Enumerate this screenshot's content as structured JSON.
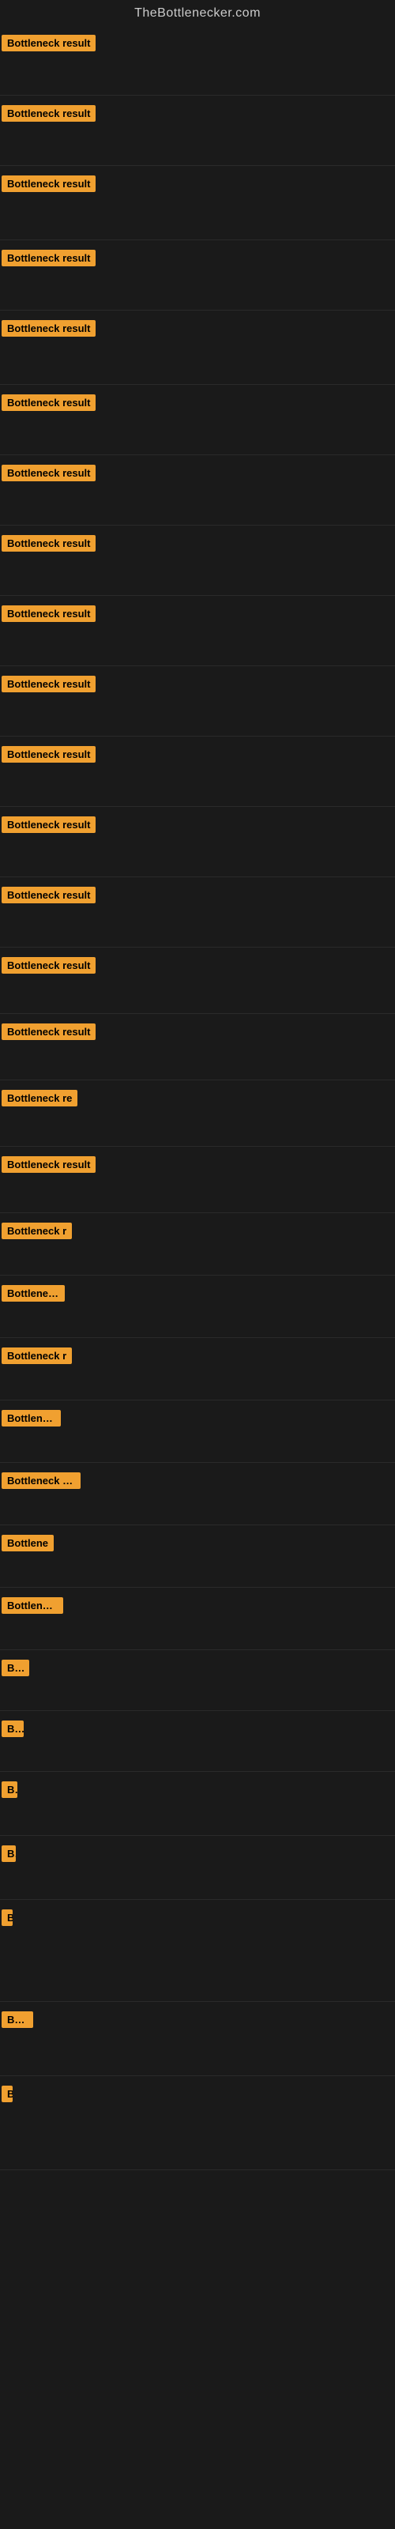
{
  "site": {
    "title": "TheBottlenecker.com"
  },
  "items": [
    {
      "id": 1,
      "label": "Bottleneck result"
    },
    {
      "id": 2,
      "label": "Bottleneck result"
    },
    {
      "id": 3,
      "label": "Bottleneck result"
    },
    {
      "id": 4,
      "label": "Bottleneck result"
    },
    {
      "id": 5,
      "label": "Bottleneck result"
    },
    {
      "id": 6,
      "label": "Bottleneck result"
    },
    {
      "id": 7,
      "label": "Bottleneck result"
    },
    {
      "id": 8,
      "label": "Bottleneck result"
    },
    {
      "id": 9,
      "label": "Bottleneck result"
    },
    {
      "id": 10,
      "label": "Bottleneck result"
    },
    {
      "id": 11,
      "label": "Bottleneck result"
    },
    {
      "id": 12,
      "label": "Bottleneck result"
    },
    {
      "id": 13,
      "label": "Bottleneck result"
    },
    {
      "id": 14,
      "label": "Bottleneck result"
    },
    {
      "id": 15,
      "label": "Bottleneck result"
    },
    {
      "id": 16,
      "label": "Bottleneck re"
    },
    {
      "id": 17,
      "label": "Bottleneck result"
    },
    {
      "id": 18,
      "label": "Bottleneck r"
    },
    {
      "id": 19,
      "label": "Bottleneck"
    },
    {
      "id": 20,
      "label": "Bottleneck r"
    },
    {
      "id": 21,
      "label": "Bottleneck"
    },
    {
      "id": 22,
      "label": "Bottleneck res"
    },
    {
      "id": 23,
      "label": "Bottlene"
    },
    {
      "id": 24,
      "label": "Bottleneck"
    },
    {
      "id": 25,
      "label": "Bot"
    },
    {
      "id": 26,
      "label": "Bo"
    },
    {
      "id": 27,
      "label": "B"
    },
    {
      "id": 28,
      "label": "B"
    },
    {
      "id": 29,
      "label": "B"
    },
    {
      "id": 30,
      "label": "Bottl"
    },
    {
      "id": 31,
      "label": "B"
    }
  ]
}
